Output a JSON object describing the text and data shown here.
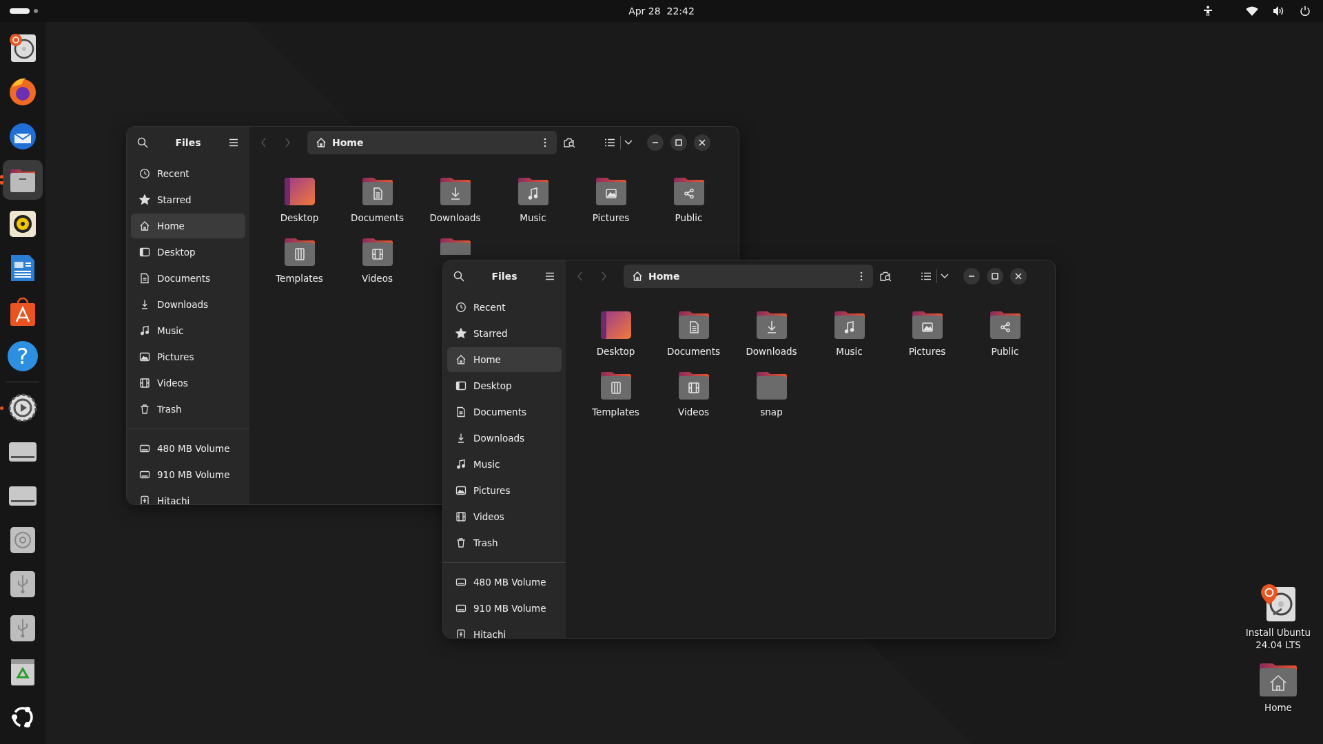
{
  "top_bar": {
    "clock": "Apr 28  22:42"
  },
  "dock": {
    "items": [
      {
        "kind": "installer",
        "running": false,
        "selected": false
      },
      {
        "kind": "browser",
        "running": false,
        "selected": false
      },
      {
        "kind": "mail",
        "running": false,
        "selected": false
      },
      {
        "kind": "files",
        "running": true,
        "multiple": true,
        "selected": true
      },
      {
        "kind": "music",
        "running": false,
        "selected": false
      },
      {
        "kind": "writer",
        "running": false,
        "selected": false
      },
      {
        "kind": "store",
        "running": false,
        "selected": false
      },
      {
        "kind": "help",
        "glyph": "?",
        "running": false,
        "selected": false
      },
      {
        "kind": "separator"
      },
      {
        "kind": "settings",
        "running": true,
        "multiple": false,
        "selected": false
      },
      {
        "kind": "drive",
        "running": false,
        "selected": false
      },
      {
        "kind": "drive",
        "running": false,
        "selected": false
      },
      {
        "kind": "disc",
        "running": false,
        "selected": false
      },
      {
        "kind": "usb",
        "running": false,
        "selected": false
      },
      {
        "kind": "usb",
        "running": false,
        "selected": false
      },
      {
        "kind": "trash",
        "running": false,
        "selected": false
      },
      {
        "kind": "apps",
        "running": false,
        "selected": false
      }
    ]
  },
  "windows": [
    {
      "title": "Files",
      "path": "Home",
      "nav": [
        {
          "kind": "back",
          "disabled": true
        },
        {
          "kind": "forward",
          "disabled": true
        }
      ],
      "places": [
        {
          "kind": "recent",
          "label": "Recent",
          "selected": false
        },
        {
          "kind": "starred",
          "label": "Starred",
          "selected": false
        },
        {
          "kind": "home",
          "label": "Home",
          "selected": true
        },
        {
          "kind": "desktop",
          "label": "Desktop",
          "selected": false
        },
        {
          "kind": "documents",
          "label": "Documents",
          "selected": false
        },
        {
          "kind": "downloads",
          "label": "Downloads",
          "selected": false
        },
        {
          "kind": "music",
          "label": "Music",
          "selected": false
        },
        {
          "kind": "pictures",
          "label": "Pictures",
          "selected": false
        },
        {
          "kind": "videos",
          "label": "Videos",
          "selected": false
        },
        {
          "kind": "trash",
          "label": "Trash",
          "selected": false
        }
      ],
      "devices": [
        {
          "kind": "drive",
          "label": "480 MB Volume",
          "selected": false
        },
        {
          "kind": "drive",
          "label": "910 MB Volume",
          "selected": false
        },
        {
          "kind": "usb",
          "label": "Hitachi",
          "selected": false
        }
      ],
      "folders": [
        {
          "kind": "desktop",
          "label": "Desktop"
        },
        {
          "kind": "documents",
          "label": "Documents"
        },
        {
          "kind": "downloads",
          "label": "Downloads"
        },
        {
          "kind": "music",
          "label": "Music"
        },
        {
          "kind": "pictures",
          "label": "Pictures"
        },
        {
          "kind": "public",
          "label": "Public"
        },
        {
          "kind": "templates",
          "label": "Templates"
        },
        {
          "kind": "videos",
          "label": "Videos"
        },
        {
          "kind": "plain"
        }
      ]
    },
    {
      "title": "Files",
      "path": "Home",
      "nav": [
        {
          "kind": "back",
          "disabled": true
        },
        {
          "kind": "forward",
          "disabled": true
        }
      ],
      "places": [
        {
          "kind": "recent",
          "label": "Recent",
          "selected": false
        },
        {
          "kind": "starred",
          "label": "Starred",
          "selected": false
        },
        {
          "kind": "home",
          "label": "Home",
          "selected": true
        },
        {
          "kind": "desktop",
          "label": "Desktop",
          "selected": false
        },
        {
          "kind": "documents",
          "label": "Documents",
          "selected": false
        },
        {
          "kind": "downloads",
          "label": "Downloads",
          "selected": false
        },
        {
          "kind": "music",
          "label": "Music",
          "selected": false
        },
        {
          "kind": "pictures",
          "label": "Pictures",
          "selected": false
        },
        {
          "kind": "videos",
          "label": "Videos",
          "selected": false
        },
        {
          "kind": "trash",
          "label": "Trash",
          "selected": false
        }
      ],
      "devices": [
        {
          "kind": "drive",
          "label": "480 MB Volume",
          "selected": false
        },
        {
          "kind": "drive",
          "label": "910 MB Volume",
          "selected": false
        },
        {
          "kind": "usb",
          "label": "Hitachi",
          "selected": false
        }
      ],
      "folders": [
        {
          "kind": "desktop",
          "label": "Desktop"
        },
        {
          "kind": "documents",
          "label": "Documents"
        },
        {
          "kind": "downloads",
          "label": "Downloads"
        },
        {
          "kind": "music",
          "label": "Music"
        },
        {
          "kind": "pictures",
          "label": "Pictures"
        },
        {
          "kind": "public",
          "label": "Public"
        },
        {
          "kind": "templates",
          "label": "Templates"
        },
        {
          "kind": "videos",
          "label": "Videos"
        },
        {
          "kind": "plain",
          "label": "snap"
        }
      ]
    }
  ],
  "desktop_icons": [
    {
      "kind": "installer",
      "label": "Install Ubuntu 24.04 LTS"
    },
    {
      "kind": "home",
      "label": "Home"
    }
  ]
}
